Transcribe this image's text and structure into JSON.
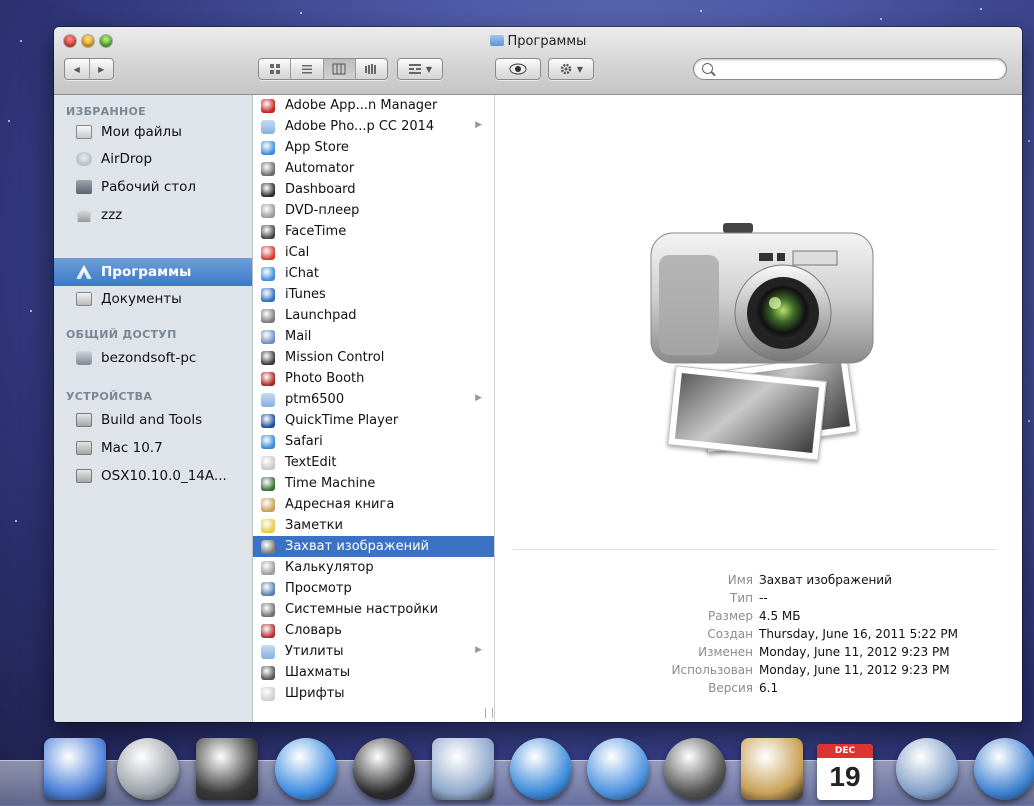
{
  "window": {
    "title": "Программы"
  },
  "toolbar": {
    "back_label": "◀",
    "forward_label": "▶",
    "view_icon": "icon-view",
    "list_icon": "list-view",
    "column_icon": "column-view",
    "coverflow_icon": "coverflow-view",
    "arrange_icon": "arrange",
    "quicklook_icon": "eye",
    "action_icon": "gear",
    "search_placeholder": ""
  },
  "sidebar": {
    "favorites_header": "ИЗБРАННОЕ",
    "favorites": [
      {
        "label": "Мои файлы",
        "icon": "all-files-icon"
      },
      {
        "label": "AirDrop",
        "icon": "airdrop-icon"
      },
      {
        "label": "Рабочий стол",
        "icon": "desktop-icon"
      },
      {
        "label": "zzz",
        "icon": "home-icon"
      },
      {
        "label": "Программы",
        "icon": "applications-icon",
        "selected": true
      },
      {
        "label": "Документы",
        "icon": "documents-icon"
      }
    ],
    "shared_header": "ОБЩИЙ ДОСТУП",
    "shared": [
      {
        "label": "bezondsoft-pc",
        "icon": "pc-icon"
      }
    ],
    "devices_header": "УСТРОЙСТВА",
    "devices": [
      {
        "label": "Build and Tools",
        "icon": "disk-icon"
      },
      {
        "label": "Mac 10.7",
        "icon": "disk-icon"
      },
      {
        "label": "OSX10.10.0_14A...",
        "icon": "disk-icon"
      }
    ]
  },
  "apps": [
    {
      "label": "Adobe App...n Manager",
      "color": "#c8201a"
    },
    {
      "label": "Adobe Pho...p CC 2014",
      "color": "#1f3d6e",
      "folder": true
    },
    {
      "label": "App Store",
      "color": "#3d8be0"
    },
    {
      "label": "Automator",
      "color": "#6b6b6b"
    },
    {
      "label": "Dashboard",
      "color": "#2d2d2d"
    },
    {
      "label": "DVD-плеер",
      "color": "#9a9a9a"
    },
    {
      "label": "FaceTime",
      "color": "#444444"
    },
    {
      "label": "iCal",
      "color": "#d63a2f"
    },
    {
      "label": "iChat",
      "color": "#3d8be0"
    },
    {
      "label": "iTunes",
      "color": "#2f6fc0"
    },
    {
      "label": "Launchpad",
      "color": "#7a7a7a"
    },
    {
      "label": "Mail",
      "color": "#6a8fc4"
    },
    {
      "label": "Mission Control",
      "color": "#3b3b3b"
    },
    {
      "label": "Photo Booth",
      "color": "#b02020"
    },
    {
      "label": "ptm6500",
      "color": "#8eb6e4",
      "folder": true
    },
    {
      "label": "QuickTime Player",
      "color": "#1d4f9a"
    },
    {
      "label": "Safari",
      "color": "#3a88d8"
    },
    {
      "label": "TextEdit",
      "color": "#c9c9c9"
    },
    {
      "label": "Time Machine",
      "color": "#3a6f3a"
    },
    {
      "label": "Адресная книга",
      "color": "#c8a056"
    },
    {
      "label": "Заметки",
      "color": "#e7c84a"
    },
    {
      "label": "Захват изображений",
      "color": "#7a7a7a",
      "selected": true
    },
    {
      "label": "Калькулятор",
      "color": "#9c9c9c"
    },
    {
      "label": "Просмотр",
      "color": "#5a7db0"
    },
    {
      "label": "Системные настройки",
      "color": "#707070"
    },
    {
      "label": "Словарь",
      "color": "#b03030"
    },
    {
      "label": "Утилиты",
      "color": "#8eb6e4",
      "folder": true
    },
    {
      "label": "Шахматы",
      "color": "#555555"
    },
    {
      "label": "Шрифты",
      "color": "#cfcfcf"
    }
  ],
  "info": [
    {
      "key": "Имя",
      "value": "Захват изображений"
    },
    {
      "key": "Тип",
      "value": "--"
    },
    {
      "key": "Размер",
      "value": "4.5 МБ"
    },
    {
      "key": "Создан",
      "value": "Thursday, June 16, 2011 5:22 PM"
    },
    {
      "key": "Изменен",
      "value": "Monday, June 11, 2012 9:23 PM"
    },
    {
      "key": "Использован",
      "value": "Monday, June 11, 2012 9:23 PM"
    },
    {
      "key": "Версия",
      "value": "6.1"
    }
  ],
  "dock": {
    "items": [
      {
        "name": "finder",
        "color": "#4a7fd8"
      },
      {
        "name": "launchpad",
        "color": "#9aa0a8"
      },
      {
        "name": "mission-control",
        "color": "#3a3a3a"
      },
      {
        "name": "app-store",
        "color": "#3d8be0"
      },
      {
        "name": "dashboard",
        "color": "#2a2a2a"
      },
      {
        "name": "mail",
        "color": "#8ea8cc"
      },
      {
        "name": "safari",
        "color": "#3a88d8"
      },
      {
        "name": "ichat",
        "color": "#4a90e0"
      },
      {
        "name": "facetime",
        "color": "#505050"
      },
      {
        "name": "address-book",
        "color": "#c8a056"
      },
      {
        "name": "ical",
        "color": "#e8e8e8"
      },
      {
        "name": "photo-booth",
        "color": "#7f9ec8"
      },
      {
        "name": "itunes",
        "color": "#3c7fd0"
      }
    ],
    "ical_month": "DEC",
    "ical_day": "19"
  }
}
